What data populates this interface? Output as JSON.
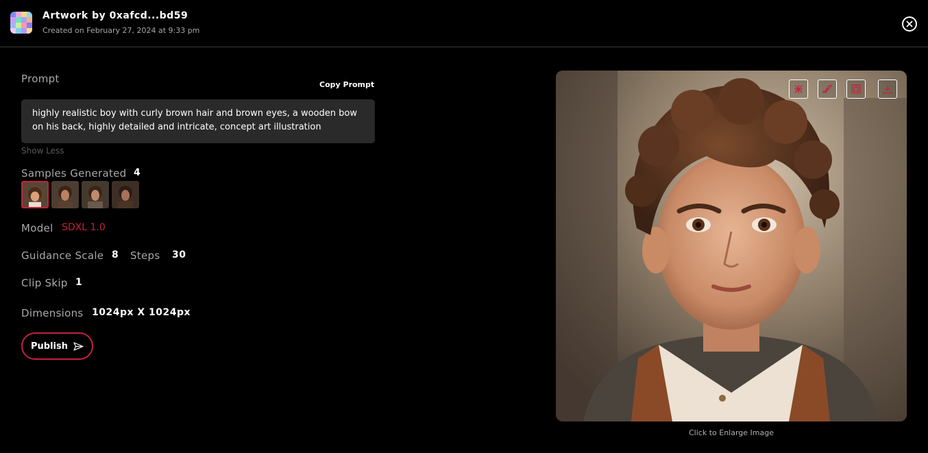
{
  "header": {
    "title": "Artwork by 0xafcd...bd59",
    "subtitle": "Created on February 27, 2024 at 9:33 pm",
    "close_icon": "close-circle-icon"
  },
  "prompt": {
    "label": "Prompt",
    "copy_label": "Copy Prompt",
    "text": "highly realistic boy with curly brown hair and brown eyes, a wooden bow on his back, highly detailed and intricate, concept art illustration",
    "toggle_label": "Show Less"
  },
  "samples": {
    "label": "Samples Generated",
    "count": "4",
    "selected_index": 0
  },
  "model": {
    "label": "Model",
    "value": "SDXL 1.0"
  },
  "guidance": {
    "label": "Guidance Scale",
    "value": "8"
  },
  "steps": {
    "label": "Steps",
    "value": "30"
  },
  "clip_skip": {
    "label": "Clip Skip",
    "value": "1"
  },
  "dimensions": {
    "label": "Dimensions",
    "value": "1024px X 1024px"
  },
  "publish": {
    "label": "Publish",
    "icon": "send-icon"
  },
  "image": {
    "caption": "Click to Enlarge Image",
    "tools": [
      "remix-icon",
      "boost-icon",
      "upscale-icon",
      "download-icon"
    ]
  },
  "colors": {
    "accent": "#c4223b",
    "background": "#000000",
    "panel": "#2a2a2a"
  }
}
